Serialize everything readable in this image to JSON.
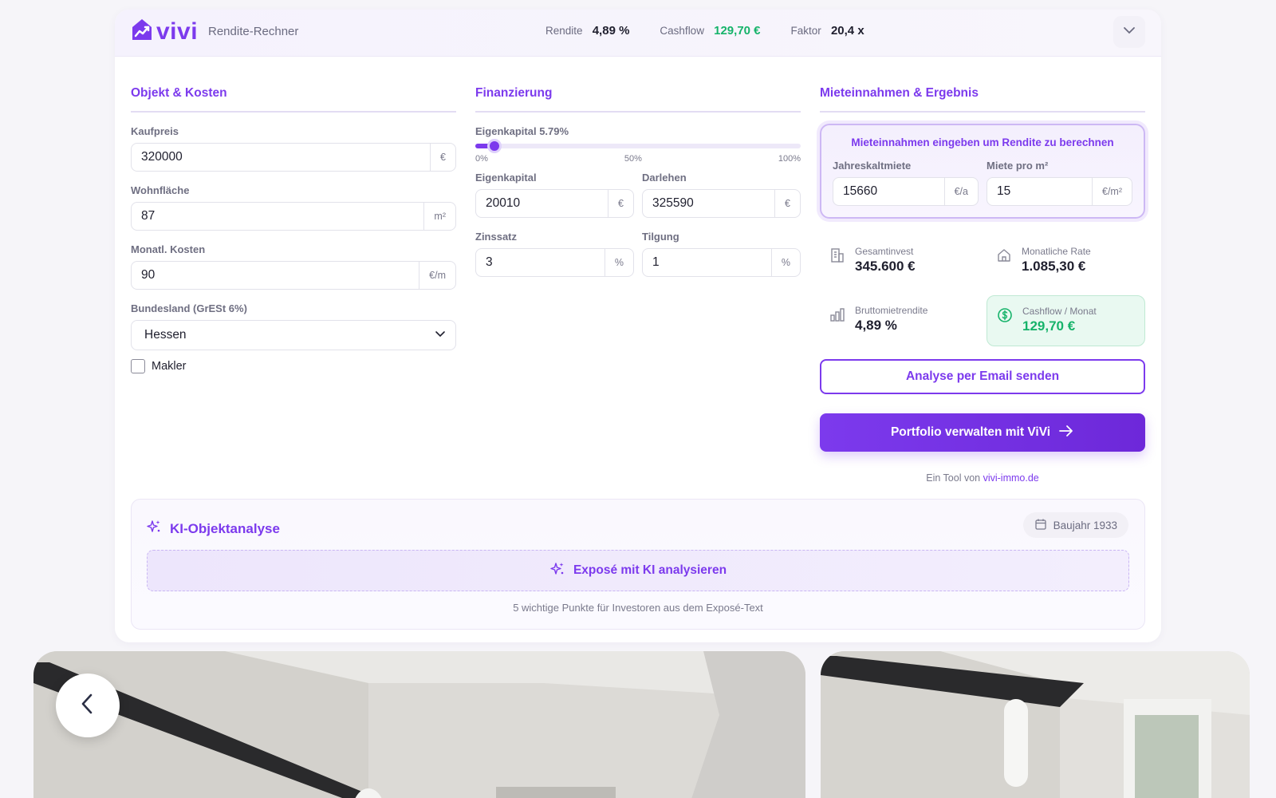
{
  "header": {
    "brand": "vivi",
    "subtitle": "Rendite-Rechner",
    "kpis": [
      {
        "label": "Rendite",
        "value": "4,89 %"
      },
      {
        "label": "Cashflow",
        "value": "129,70 €"
      },
      {
        "label": "Faktor",
        "value": "20,4 x"
      }
    ]
  },
  "objekt": {
    "title": "Objekt & Kosten",
    "kaufpreis_label": "Kaufpreis",
    "kaufpreis": "320000",
    "kaufpreis_unit": "€",
    "wohnflaeche_label": "Wohnfläche",
    "wohnflaeche": "87",
    "wohnflaeche_unit": "m²",
    "kosten_label": "Monatl. Kosten",
    "kosten": "90",
    "kosten_unit": "€/m",
    "bundesland_label": "Bundesland (GrESt 6%)",
    "bundesland": "Hessen",
    "makler_label": "Makler"
  },
  "finanzierung": {
    "title": "Finanzierung",
    "slider_label": "Eigenkapital 5.79%",
    "slider_value": 0.0579,
    "ticks": [
      "0%",
      "50%",
      "100%"
    ],
    "eigenkapital_label": "Eigenkapital",
    "eigenkapital": "20010",
    "eigenkapital_unit": "€",
    "darlehen_label": "Darlehen",
    "darlehen": "325590",
    "darlehen_unit": "€",
    "zinssatz_label": "Zinssatz",
    "zinssatz": "3",
    "zinssatz_unit": "%",
    "tilgung_label": "Tilgung",
    "tilgung": "1",
    "tilgung_unit": "%"
  },
  "ergebnis": {
    "title": "Mieteinnahmen & Ergebnis",
    "hint": "Mieteinnahmen eingeben um Rendite zu berechnen",
    "jahresmiete_label": "Jahreskaltmiete",
    "jahresmiete": "15660",
    "jahresmiete_unit": "€/a",
    "miete_qm_label": "Miete pro m²",
    "miete_qm": "15",
    "miete_qm_unit": "€/m²",
    "gesamtinvest_label": "Gesamtinvest",
    "gesamtinvest": "345.600 €",
    "rate_label": "Monatliche Rate",
    "rate": "1.085,30 €",
    "brutto_label": "Bruttomietrendite",
    "brutto": "4,89 %",
    "cashflow_label": "Cashflow / Monat",
    "cashflow": "129,70 €",
    "email_button": "Analyse per Email senden",
    "portfolio_button": "Portfolio verwalten mit ViVi",
    "footer_prefix": "Ein Tool von",
    "footer_link": "vivi-immo.de"
  },
  "ki": {
    "title": "KI-Objektanalyse",
    "baujahr": "Baujahr 1933",
    "button": "Exposé mit KI analysieren",
    "note": "5 wichtige Punkte für Investoren aus dem Exposé-Text"
  },
  "colors": {
    "accent": "#7c3aed",
    "positive": "#16b36a"
  }
}
